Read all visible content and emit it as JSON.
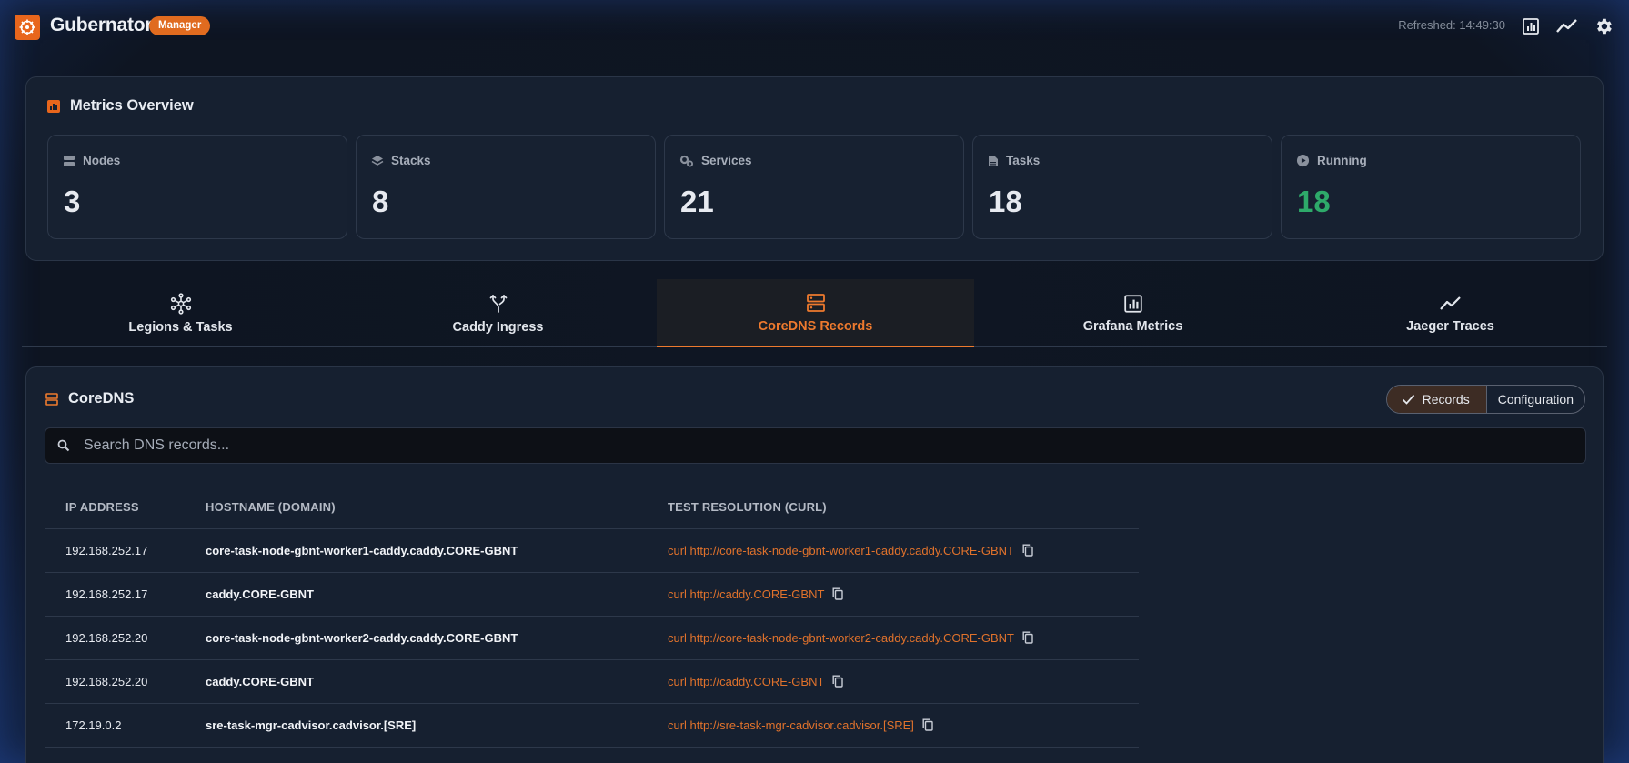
{
  "header": {
    "app_name": "Gubernator",
    "role_badge": "Manager",
    "refreshed": "Refreshed: 14:49:30"
  },
  "metrics": {
    "title": "Metrics Overview",
    "stats": [
      {
        "label": "Nodes",
        "value": "3",
        "icon": "server-icon"
      },
      {
        "label": "Stacks",
        "value": "8",
        "icon": "layers-icon"
      },
      {
        "label": "Services",
        "value": "21",
        "icon": "gears-icon"
      },
      {
        "label": "Tasks",
        "value": "18",
        "icon": "document-icon"
      },
      {
        "label": "Running",
        "value": "18",
        "icon": "play-circle-icon"
      }
    ]
  },
  "tabs": [
    {
      "label": "Legions & Tasks",
      "icon": "network-hub-icon"
    },
    {
      "label": "Caddy Ingress",
      "icon": "merge-arrows-icon"
    },
    {
      "label": "CoreDNS Records",
      "icon": "dns-icon",
      "active": true
    },
    {
      "label": "Grafana Metrics",
      "icon": "bar-chart-icon"
    },
    {
      "label": "Jaeger Traces",
      "icon": "trend-line-icon"
    }
  ],
  "coredns": {
    "title": "CoreDNS",
    "view_toggle": {
      "records": "Records",
      "configuration": "Configuration",
      "selected": "Records"
    },
    "search_placeholder": "Search DNS records...",
    "columns": [
      "IP ADDRESS",
      "HOSTNAME (DOMAIN)",
      "TEST RESOLUTION (CURL)"
    ],
    "rows": [
      {
        "ip": "192.168.252.17",
        "host": "core-task-node-gbnt-worker1-caddy.caddy.CORE-GBNT",
        "curl": "curl http://core-task-node-gbnt-worker1-caddy.caddy.CORE-GBNT"
      },
      {
        "ip": "192.168.252.17",
        "host": "caddy.CORE-GBNT",
        "curl": "curl http://caddy.CORE-GBNT"
      },
      {
        "ip": "192.168.252.20",
        "host": "core-task-node-gbnt-worker2-caddy.caddy.CORE-GBNT",
        "curl": "curl http://core-task-node-gbnt-worker2-caddy.caddy.CORE-GBNT"
      },
      {
        "ip": "192.168.252.20",
        "host": "caddy.CORE-GBNT",
        "curl": "curl http://caddy.CORE-GBNT"
      },
      {
        "ip": "172.19.0.2",
        "host": "sre-task-mgr-cadvisor.cadvisor.[SRE]",
        "curl": "curl http://sre-task-mgr-cadvisor.cadvisor.[SRE]"
      }
    ]
  },
  "colors": {
    "accent": "#ee7a2e",
    "running": "#2eaa6a",
    "background": "#0f1623"
  }
}
